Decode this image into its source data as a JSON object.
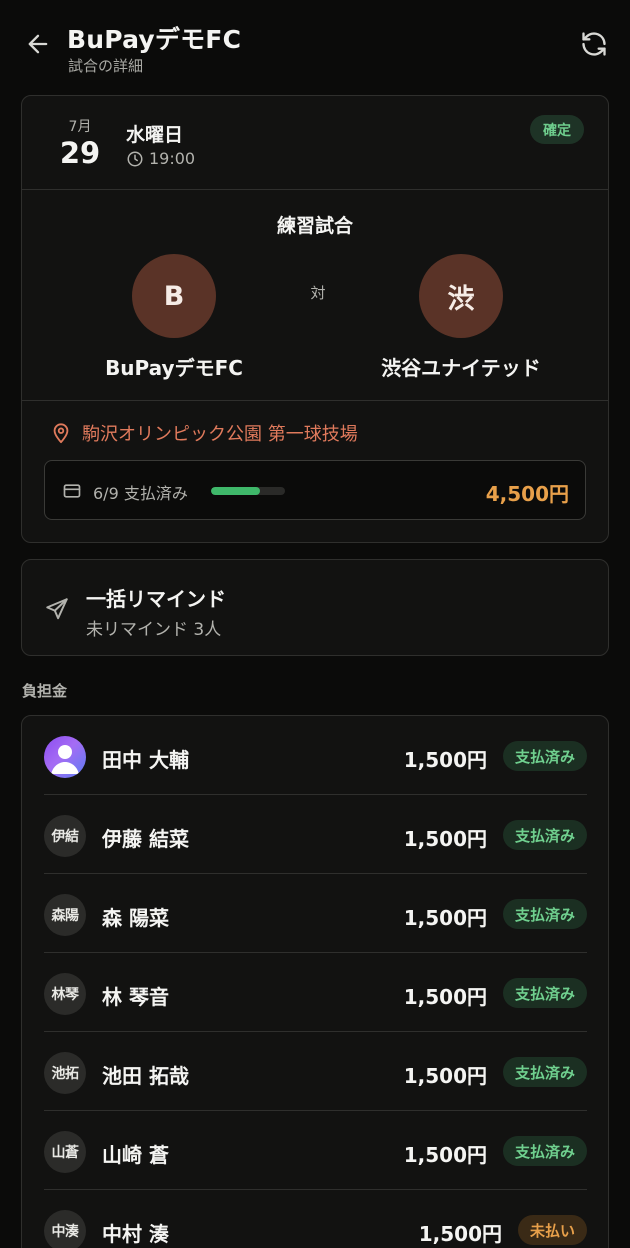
{
  "header": {
    "title": "BuPayデモFC",
    "subtitle": "試合の詳細"
  },
  "match": {
    "month": "7月",
    "day": "29",
    "weekday": "水曜日",
    "time": "19:00",
    "status": "確定",
    "type": "練習試合",
    "vs": "対",
    "home": {
      "initial": "B",
      "name": "BuPayデモFC"
    },
    "away": {
      "initial": "渋",
      "name": "渋谷ユナイテッド"
    },
    "venue": "駒沢オリンピック公園 第一球技場",
    "payment": {
      "count": "6/9 支払済み",
      "progress": 0.6667,
      "amount": "4,500円"
    }
  },
  "remind": {
    "title": "一括リマインド",
    "subtitle": "未リマインド 3人"
  },
  "members_section": {
    "label": "負担金",
    "members": [
      {
        "initials": "",
        "name": "田中 大輔",
        "amount": "1,500円",
        "status": "支払済み",
        "photo": true
      },
      {
        "initials": "伊結",
        "name": "伊藤 結菜",
        "amount": "1,500円",
        "status": "支払済み"
      },
      {
        "initials": "森陽",
        "name": "森 陽菜",
        "amount": "1,500円",
        "status": "支払済み"
      },
      {
        "initials": "林琴",
        "name": "林 琴音",
        "amount": "1,500円",
        "status": "支払済み"
      },
      {
        "initials": "池拓",
        "name": "池田 拓哉",
        "amount": "1,500円",
        "status": "支払済み"
      },
      {
        "initials": "山蒼",
        "name": "山崎 蒼",
        "amount": "1,500円",
        "status": "支払済み"
      },
      {
        "initials": "中湊",
        "name": "中村 湊",
        "amount": "1,500円",
        "status": "未払い"
      }
    ]
  },
  "colors": {
    "background": "#0b0b0a",
    "accent_green": "#3fb86a",
    "accent_orange": "#e8a04a",
    "venue_red": "#e07a5c",
    "team_logo": "#5a3327"
  },
  "icons": {
    "back": "arrow-left-icon",
    "refresh": "refresh-icon",
    "clock": "clock-icon",
    "location": "map-pin-icon",
    "payment": "credit-card-icon",
    "remind": "send-icon",
    "avatar": "user-icon"
  }
}
